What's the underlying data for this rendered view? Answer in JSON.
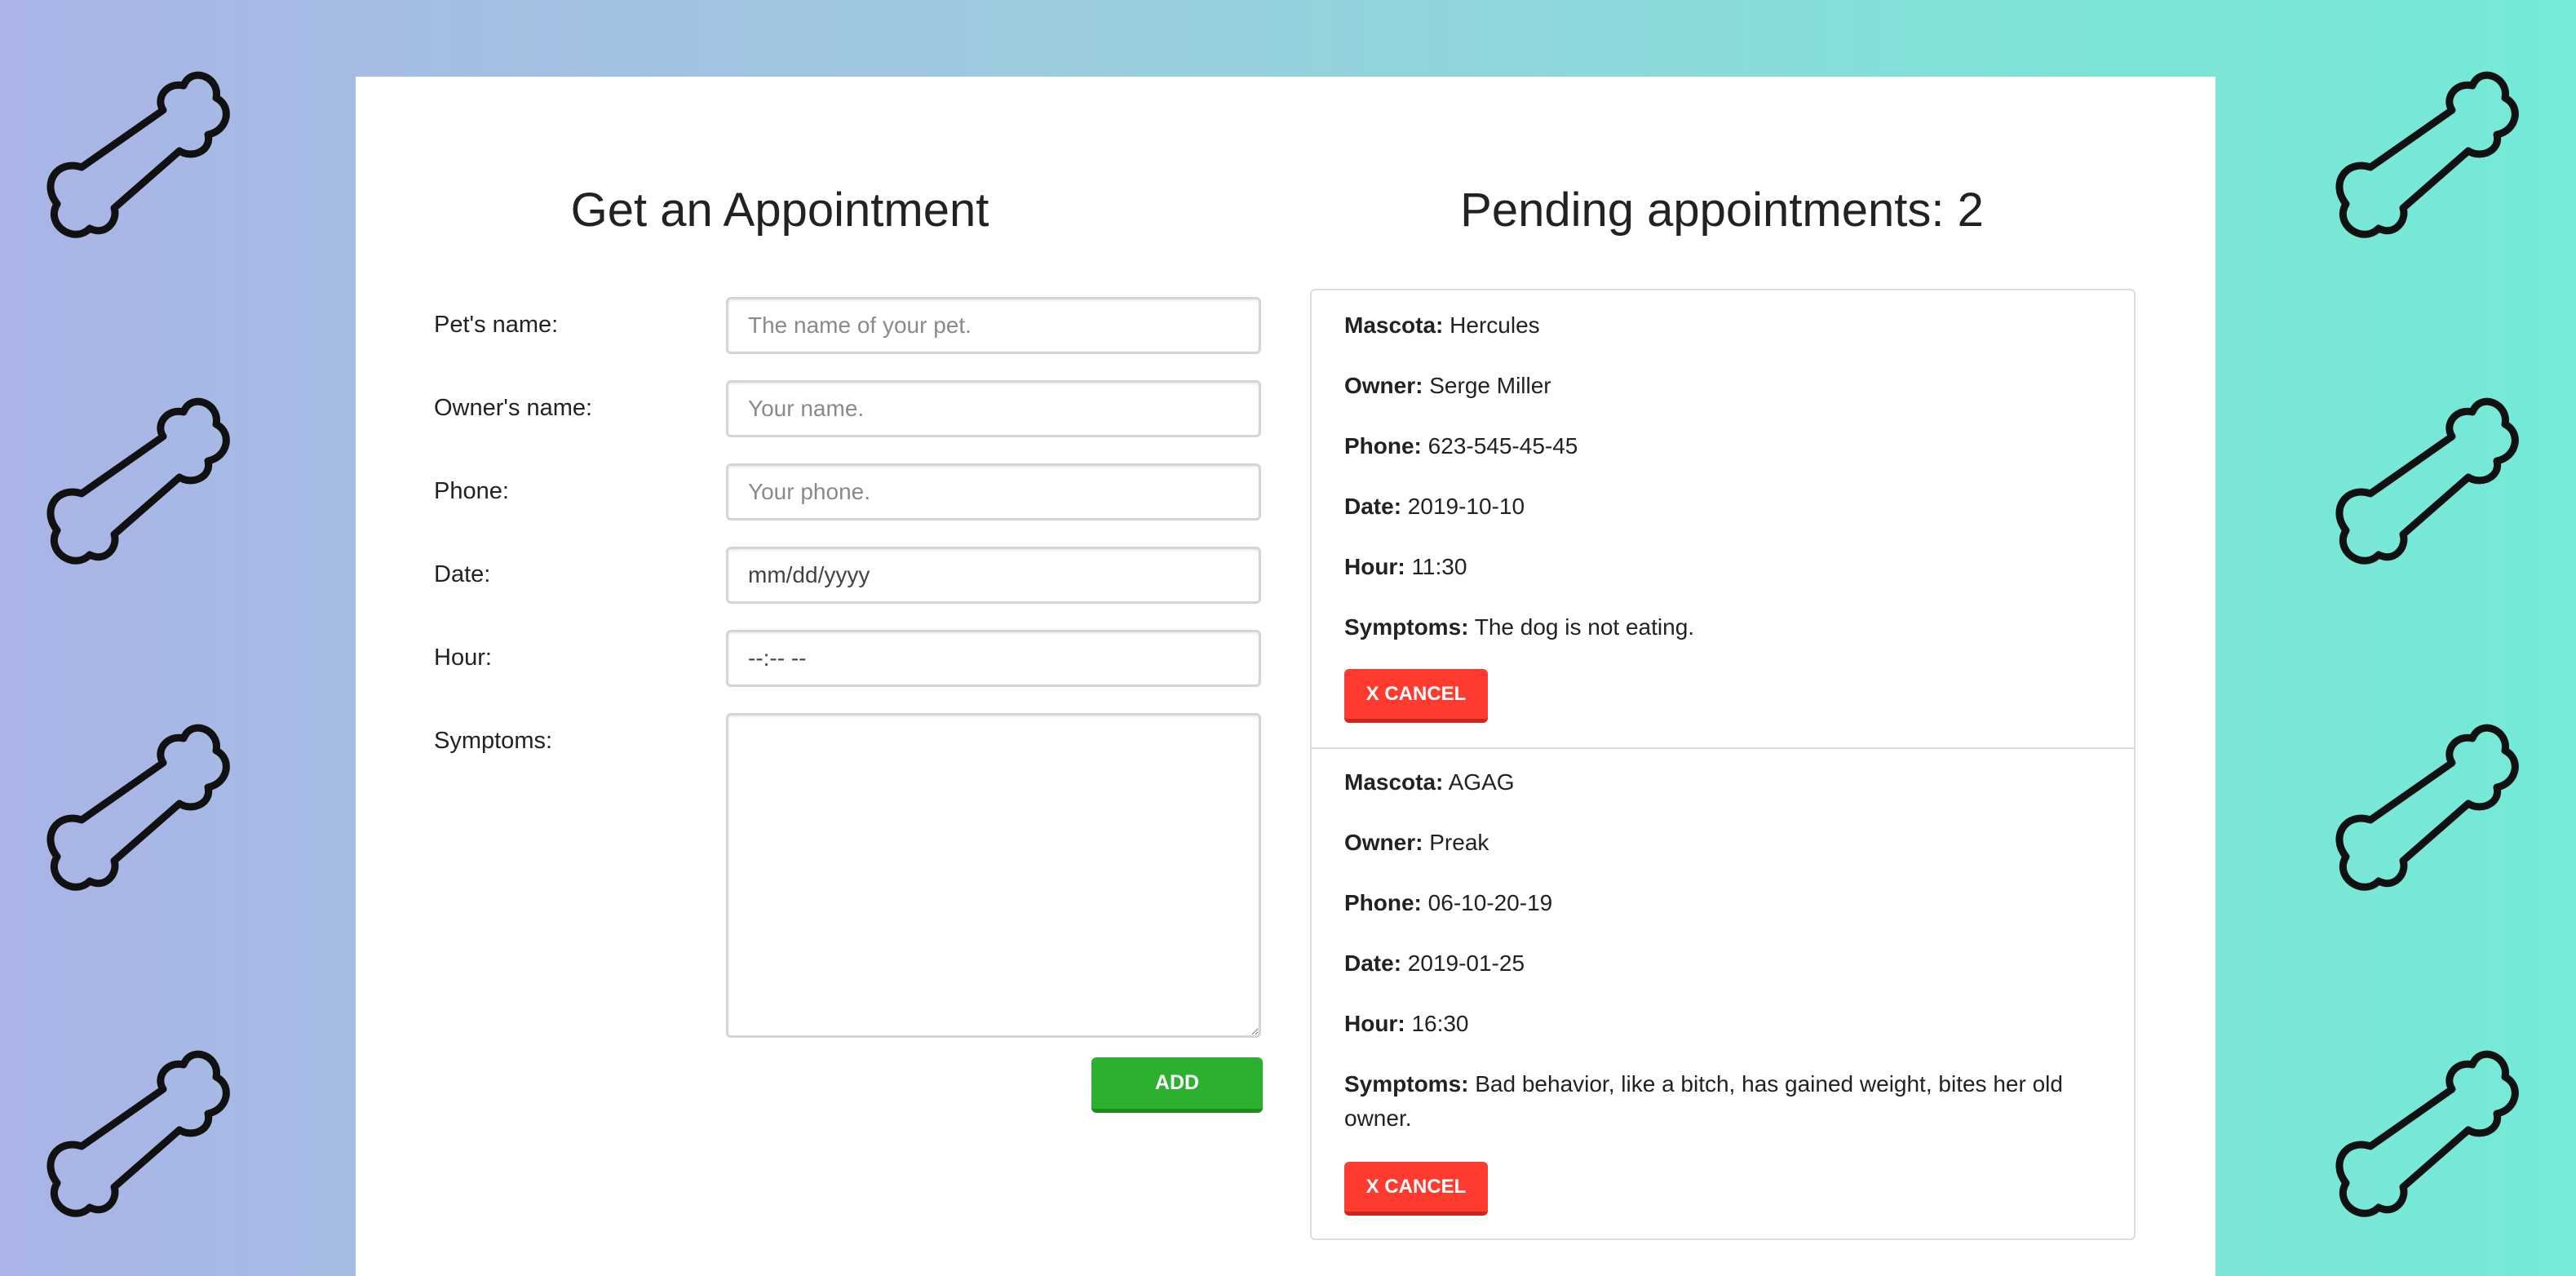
{
  "form": {
    "title": "Get an Appointment",
    "fields": [
      {
        "label": "Pet's name:",
        "placeholder": "The name of your pet."
      },
      {
        "label": "Owner's name:",
        "placeholder": "Your name."
      },
      {
        "label": "Phone:",
        "placeholder": "Your phone."
      },
      {
        "label": "Date:",
        "value": "mm/dd/yyyy"
      },
      {
        "label": "Hour:",
        "value": "--:-- --"
      },
      {
        "label": "Symptoms:",
        "value": ""
      }
    ],
    "add_label": "ADD"
  },
  "list": {
    "title": "Pending appointments: 2",
    "field_labels": {
      "pet": "Mascota:",
      "owner": "Owner:",
      "phone": "Phone:",
      "date": "Date:",
      "hour": "Hour:",
      "symptoms": "Symptoms:"
    },
    "cancel_label": "X CANCEL",
    "appointments": [
      {
        "pet": "Hercules",
        "owner": "Serge Miller",
        "phone": "623-545-45-45",
        "date": "2019-10-10",
        "hour": "11:30",
        "symptoms": "The dog is not eating."
      },
      {
        "pet": "AGAG",
        "owner": "Preak",
        "phone": "06-10-20-19",
        "date": "2019-01-25",
        "hour": "16:30",
        "symptoms": "Bad behavior, like a bitch, has gained weight, bites her old owner."
      }
    ]
  },
  "colors": {
    "add_button": "#2bb12f",
    "cancel_button": "#ff3b30",
    "gradient_start": "#aab4e7",
    "gradient_end": "#74ead7"
  },
  "icons": {
    "background": "bone-icon"
  }
}
